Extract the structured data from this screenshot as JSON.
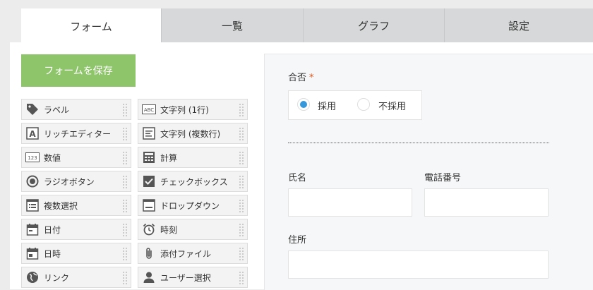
{
  "tabs": [
    {
      "label": "フォーム",
      "active": true
    },
    {
      "label": "一覧"
    },
    {
      "label": "グラフ"
    },
    {
      "label": "設定"
    }
  ],
  "save_button": "フォームを保存",
  "palette": [
    {
      "label": "ラベル",
      "icon": "tag-icon"
    },
    {
      "label": "文字列 (1行)",
      "icon": "abc-text-icon"
    },
    {
      "label": "リッチエディター",
      "icon": "rich-editor-icon"
    },
    {
      "label": "文字列 (複数行)",
      "icon": "multiline-text-icon"
    },
    {
      "label": "数値",
      "icon": "number-icon"
    },
    {
      "label": "計算",
      "icon": "calculator-icon"
    },
    {
      "label": "ラジオボタン",
      "icon": "radio-button-icon"
    },
    {
      "label": "チェックボックス",
      "icon": "checkbox-icon"
    },
    {
      "label": "複数選択",
      "icon": "multi-select-icon"
    },
    {
      "label": "ドロップダウン",
      "icon": "dropdown-icon"
    },
    {
      "label": "日付",
      "icon": "calendar-icon"
    },
    {
      "label": "時刻",
      "icon": "alarm-clock-icon"
    },
    {
      "label": "日時",
      "icon": "calendar-time-icon"
    },
    {
      "label": "添付ファイル",
      "icon": "paperclip-icon"
    },
    {
      "label": "リンク",
      "icon": "globe-link-icon"
    },
    {
      "label": "ユーザー選択",
      "icon": "user-icon"
    }
  ],
  "form": {
    "approval": {
      "label": "合否",
      "required_mark": "*",
      "options": [
        "採用",
        "不採用"
      ],
      "selected": "採用"
    },
    "name_label": "氏名",
    "phone_label": "電話番号",
    "address_label": "住所"
  },
  "colors": {
    "save_button": "#8ec56a",
    "radio_selected": "#3498db",
    "required_mark": "#e0551b"
  }
}
